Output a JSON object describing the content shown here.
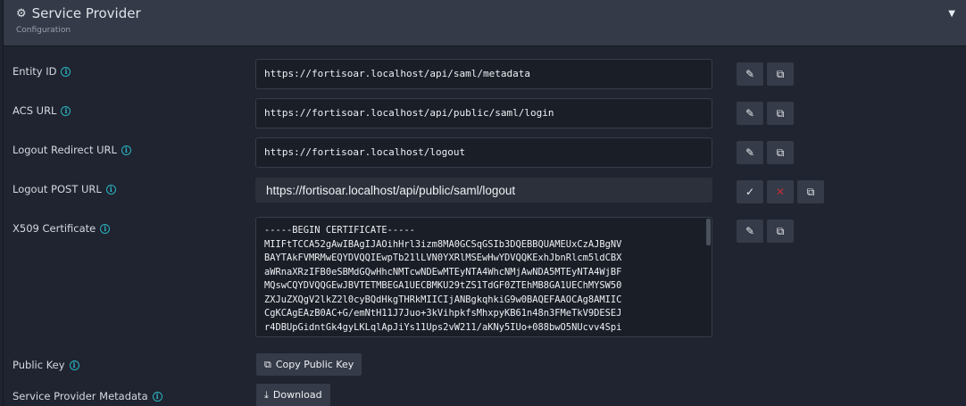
{
  "header": {
    "title": "Service Provider",
    "subtitle": "Configuration"
  },
  "fields": [
    {
      "label": "Entity ID",
      "value": "https://fortisoar.localhost/api/saml/metadata"
    },
    {
      "label": "ACS URL",
      "value": "https://fortisoar.localhost/api/public/saml/login"
    },
    {
      "label": "Logout Redirect URL",
      "value": "https://fortisoar.localhost/logout"
    },
    {
      "label": "Logout POST URL",
      "value": "https://fortisoar.localhost/api/public/saml/logout"
    }
  ],
  "certificate": {
    "label": "X509 Certificate",
    "value": "-----BEGIN CERTIFICATE-----\nMIIFtTCCA52gAwIBAgIJAOihHrl3izm8MA0GCSqGSIb3DQEBBQUAMEUxCzAJBgNV\nBAYTAkFVMRMwEQYDVQQIEwpTb21lLVN0YXRlMSEwHwYDVQQKExhJbnRlcm5ldCBX\naWRnaXRzIFB0eSBMdGQwHhcNMTcwNDEwMTEyNTA4WhcNMjAwNDA5MTEyNTA4WjBF\nMQswCQYDVQQGEwJBVTETMBEGA1UECBMKU29tZS1TdGF0ZTEhMB8GA1UEChMYSW50\nZXJuZXQgV2lkZ2l0cyBQdHkgTHRkMIICIjANBgkqhkiG9w0BAQEFAAOCAg8AMIIC\nCgKCAgEAzB0AC+G/emNtH11J7Juo+3kVihpkfsMhxpyKB61n48n3FMeTkV9DESEJ\nr4DBUpGidntGk4gyLKLqlApJiYs11Ups2vW211/aKNy5IUo+088bwO5NUcvv4Spi"
  },
  "public_key": {
    "label": "Public Key",
    "button": "Copy Public Key"
  },
  "metadata": {
    "label": "Service Provider Metadata",
    "button": "Download"
  }
}
